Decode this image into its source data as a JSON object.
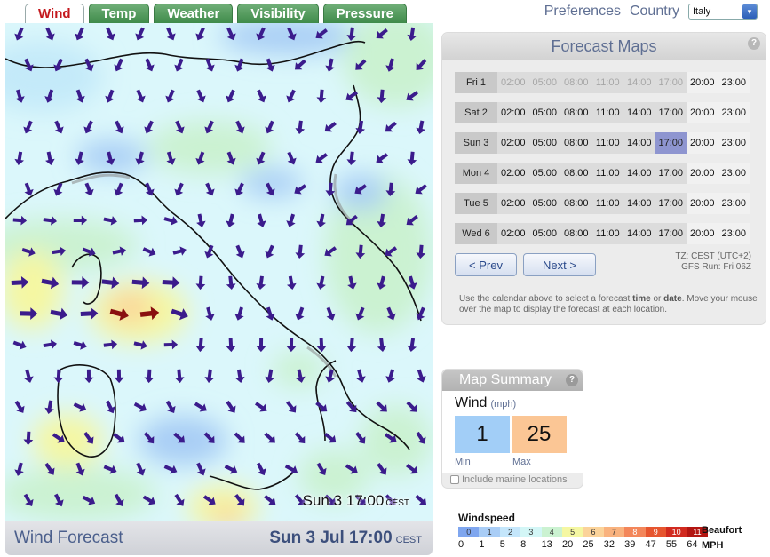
{
  "tabs": [
    {
      "label": "Wind",
      "active": true
    },
    {
      "label": "Temp",
      "active": false
    },
    {
      "label": "Weather",
      "active": false
    },
    {
      "label": "Visibility",
      "active": false
    },
    {
      "label": "Pressure",
      "active": false
    }
  ],
  "topnav": {
    "preferences": "Preferences",
    "country_label": "Country",
    "country_value": "Italy"
  },
  "map": {
    "stamp_time": "Sun 3 17:00",
    "stamp_tz": "CEST"
  },
  "footer": {
    "title": "Wind Forecast",
    "date": "Sun 3 Jul 17:00",
    "tz": "CEST"
  },
  "forecast_maps": {
    "title": "Forecast Maps",
    "help": "?",
    "times": [
      "02:00",
      "05:00",
      "08:00",
      "11:00",
      "14:00",
      "17:00",
      "20:00",
      "23:00"
    ],
    "days": [
      {
        "label": "Fri 1",
        "past_count": 6
      },
      {
        "label": "Sat 2",
        "past_count": 0
      },
      {
        "label": "Sun 3",
        "past_count": 0,
        "selected_index": 5
      },
      {
        "label": "Mon 4",
        "past_count": 0
      },
      {
        "label": "Tue 5",
        "past_count": 0
      },
      {
        "label": "Wed 6",
        "past_count": 0
      }
    ],
    "prev_label": "< Prev",
    "next_label": "Next >",
    "tz_line": "TZ: CEST (UTC+2)",
    "gfs_line": "GFS Run: Fri 06Z",
    "help_pre": "Use the calendar above to select a forecast ",
    "help_b1": "time",
    "help_mid": " or ",
    "help_b2": "date",
    "help_post": ". Move your mouse over the map to display the forecast at each location."
  },
  "map_summary": {
    "title": "Map Summary",
    "help": "?",
    "variable": "Wind",
    "unit": "(mph)",
    "min_value": "1",
    "max_value": "25",
    "min_label": "Min",
    "max_label": "Max",
    "marine_label": "Include marine locations"
  },
  "legend": {
    "title": "Windspeed",
    "scale_name": "Beaufort",
    "mph_name": "MPH",
    "beaufort": [
      "0",
      "1",
      "2",
      "3",
      "4",
      "5",
      "6",
      "7",
      "8",
      "9",
      "10",
      "11"
    ],
    "mph": [
      "0",
      "1",
      "5",
      "8",
      "13",
      "20",
      "25",
      "32",
      "39",
      "47",
      "55",
      "64"
    ],
    "colors": [
      "#7fa6ef",
      "#a9cdf6",
      "#c4e6fb",
      "#d3f6f6",
      "#cbf2d1",
      "#f5f7a2",
      "#fbd39a",
      "#f9b27e",
      "#f3865a",
      "#e6552f",
      "#d12a1f",
      "#b31612"
    ]
  },
  "colors": {
    "tab_green": "#4f9a5a",
    "tab_active_text": "#c4181d",
    "arrow": "#3b1b8c",
    "arrow_strong": "#8a1010",
    "selected_time": "#8e95d0"
  },
  "icons": {
    "help": "question-circle-icon",
    "dropdown": "chevron-down-icon",
    "wind_arrow": "arrow-icon",
    "checkbox": "checkbox-icon"
  }
}
